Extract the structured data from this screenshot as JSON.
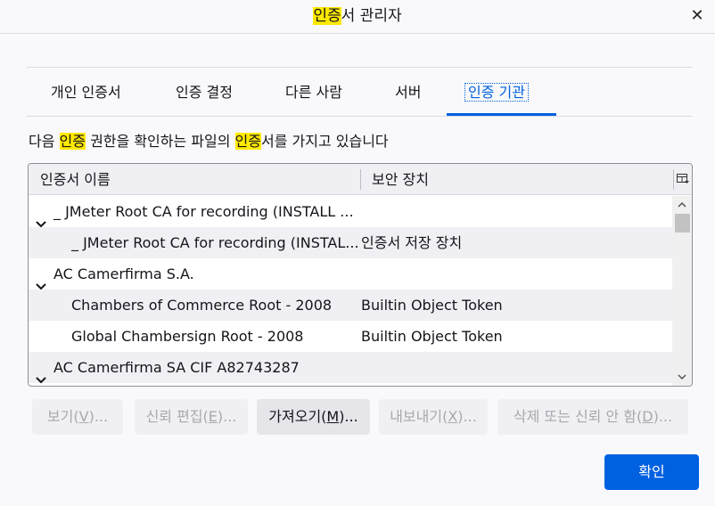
{
  "window": {
    "title_highlight": "인증",
    "title_rest": "서 관리자",
    "close_symbol": "✕"
  },
  "tabs": [
    {
      "label": "개인 인증서"
    },
    {
      "label": "인증 결정"
    },
    {
      "label": "다른 사람"
    },
    {
      "label": "서버"
    },
    {
      "label": "인증 기관",
      "selected": true
    }
  ],
  "description": {
    "part1": "다음 ",
    "hl1": "인증",
    "part2": " 권한을 확인하는 파일의 ",
    "hl2": "인증",
    "part3": "서를 가지고 있습니다"
  },
  "table": {
    "columns": [
      "인증서 이름",
      "보안 장치"
    ],
    "rows": [
      {
        "name": "_ JMeter Root CA for recording (INSTALL ...",
        "device": "",
        "group": true
      },
      {
        "name": "_ JMeter Root CA for recording (INSTAL...",
        "device": "인증서 저장 장치",
        "group": false
      },
      {
        "name": "AC Camerfirma S.A.",
        "device": "",
        "group": true
      },
      {
        "name": "Chambers of Commerce Root - 2008",
        "device": "Builtin Object Token",
        "group": false
      },
      {
        "name": "Global Chambersign Root - 2008",
        "device": "Builtin Object Token",
        "group": false
      },
      {
        "name": "AC Camerfirma SA CIF A82743287",
        "device": "",
        "group": true
      }
    ]
  },
  "buttons": {
    "view": {
      "text": "보기(",
      "key": "V",
      "suffix": ")..."
    },
    "edit_trust": {
      "text": "신뢰 편집(",
      "key": "E",
      "suffix": ")..."
    },
    "import": {
      "text": "가져오기(",
      "key": "M",
      "suffix": ")..."
    },
    "export": {
      "text": "내보내기(",
      "key": "X",
      "suffix": ")..."
    },
    "delete": {
      "text": "삭제 또는 신뢰 안 함(",
      "key": "D",
      "suffix": ")..."
    },
    "ok": "확인"
  },
  "colors": {
    "accent": "#0061e0",
    "highlight": "#ffe900"
  }
}
